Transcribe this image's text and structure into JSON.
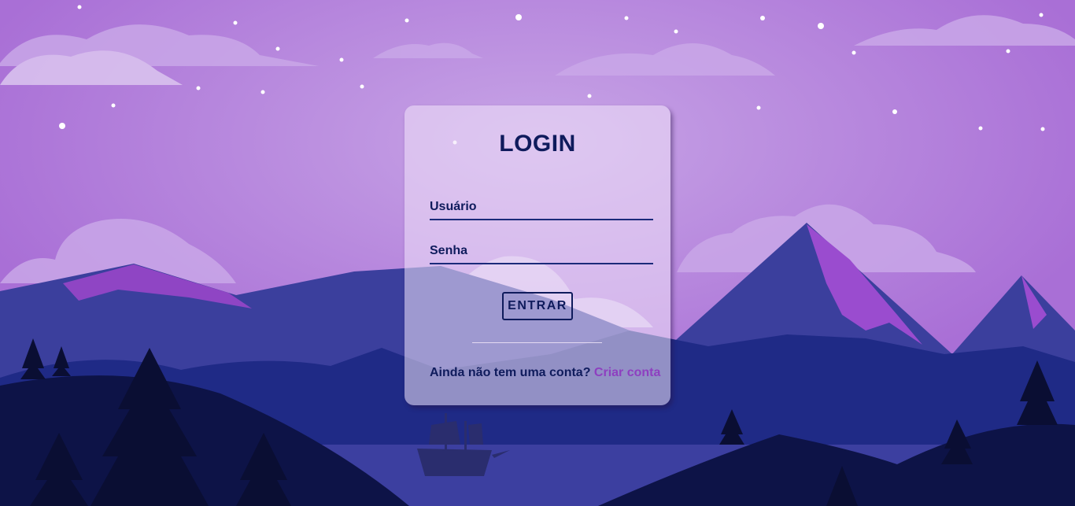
{
  "login": {
    "title": "LOGIN",
    "username_placeholder": "Usuário",
    "password_placeholder": "Senha",
    "submit_label": "ENTRAR",
    "signup_prompt": "Ainda não tem uma conta?",
    "signup_link": "Criar conta"
  },
  "colors": {
    "sky": "#ab72d8",
    "text_dark": "#0f1b5c",
    "link": "#8e3fc0",
    "mountain": "#3a3f9c"
  }
}
